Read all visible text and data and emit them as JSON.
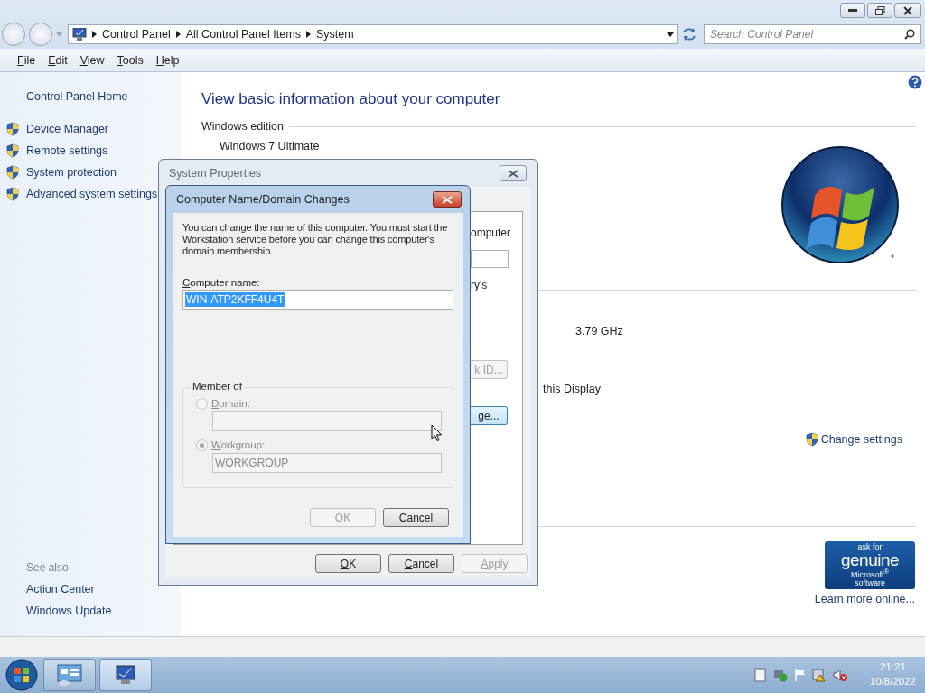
{
  "address_bar": {
    "breadcrumbs": [
      "Control Panel",
      "All Control Panel Items",
      "System"
    ]
  },
  "search": {
    "placeholder": "Search Control Panel"
  },
  "menu": [
    "File",
    "Edit",
    "View",
    "Tools",
    "Help"
  ],
  "sidebar": {
    "home": "Control Panel Home",
    "tasks": [
      "Device Manager",
      "Remote settings",
      "System protection",
      "Advanced system settings"
    ],
    "see_also": {
      "heading": "See also",
      "links": [
        "Action Center",
        "Windows Update"
      ]
    }
  },
  "main": {
    "title": "View basic information about your computer",
    "edition_heading": "Windows edition",
    "edition": "Windows 7 Ultimate",
    "processor_speed": "3.79 GHz",
    "display_note": "this Display",
    "change_settings": "Change settings",
    "genuine_badge": [
      "ask for",
      "genuine",
      "Microsoft$^{®}$",
      "software"
    ],
    "learn_more": "Learn more online..."
  },
  "system_properties": {
    "title": "System Properties",
    "text_1": "omputer",
    "text_2": "ry's",
    "button_1": {
      "label": "k ID...",
      "disabled": true
    },
    "button_2": {
      "label": "ge...",
      "disabled": false
    },
    "buttons": [
      {
        "label": "OK",
        "disabled": false
      },
      {
        "label": "Cancel",
        "disabled": false
      },
      {
        "label": "Apply",
        "disabled": true
      }
    ]
  },
  "name_dialog": {
    "title": "Computer Name/Domain Changes",
    "intro": "You can change the name of this computer.  You must start the Workstation service before you can change this computer's domain membership.",
    "name_label": "Computer name:",
    "name_value": "WIN-ATP2KFF4U4T",
    "name_text_selected": true,
    "member_of": "Member of",
    "options": [
      {
        "label": "Domain:",
        "selected": false,
        "disabled": true
      },
      {
        "label": "Workgroup:",
        "selected": true,
        "disabled": true,
        "value": "WORKGROUP"
      }
    ],
    "buttons": [
      {
        "label": "OK",
        "disabled": true
      },
      {
        "label": "Cancel",
        "disabled": false
      }
    ]
  },
  "taskbar": {
    "clock": {
      "time": "21:21",
      "date": "10/8/2022"
    }
  }
}
